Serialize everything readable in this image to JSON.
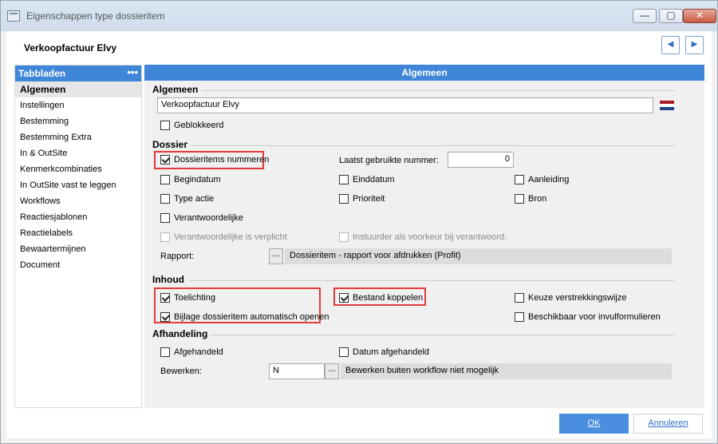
{
  "window": {
    "title": "Eigenschappen type dossieritem",
    "minimize_glyph": "—",
    "maximize_glyph": "▢",
    "close_glyph": "✕"
  },
  "header": {
    "title": "Verkoopfactuur Elvy",
    "prev_glyph": "◀",
    "next_glyph": "▶"
  },
  "sidebar": {
    "title": "Tabbladen",
    "more_glyph": "•••",
    "items": [
      {
        "label": "Algemeen",
        "active": true
      },
      {
        "label": "Instellingen"
      },
      {
        "label": "Bestemming"
      },
      {
        "label": "Bestemming Extra"
      },
      {
        "label": "In & OutSite"
      },
      {
        "label": "Kenmerkcombinaties"
      },
      {
        "label": "In OutSite vast te leggen"
      },
      {
        "label": "Workflows"
      },
      {
        "label": "Reactiesjablonen"
      },
      {
        "label": "Reactielabels"
      },
      {
        "label": "Bewaartermijnen"
      },
      {
        "label": "Document"
      }
    ]
  },
  "main": {
    "title": "Algemeen",
    "algemeen": {
      "section": "Algemeen",
      "name_value": "Verkoopfactuur Elvy",
      "geblokkeerd": {
        "label": "Geblokkeerd",
        "checked": false
      }
    },
    "dossier": {
      "section": "Dossier",
      "nummeren": {
        "label": "Dossieritems nummeren",
        "checked": true
      },
      "laatst_label": "Laatst gebruikte nummer:",
      "laatst_value": "0",
      "begindatum": {
        "label": "Begindatum",
        "checked": false
      },
      "einddatum": {
        "label": "Einddatum",
        "checked": false
      },
      "aanleiding": {
        "label": "Aanleiding",
        "checked": false
      },
      "type_actie": {
        "label": "Type actie",
        "checked": false
      },
      "prioriteit": {
        "label": "Prioriteit",
        "checked": false
      },
      "bron": {
        "label": "Bron",
        "checked": false
      },
      "verantwoordelijke": {
        "label": "Verantwoordelijke",
        "checked": false
      },
      "verplicht": {
        "label": "Verantwoordelijke is verplicht",
        "checked": false
      },
      "instuurder": {
        "label": "Instuurder als voorkeur bij verantwoord.",
        "checked": false
      },
      "rapport_label": "Rapport:",
      "rapport_button": "...",
      "rapport_value": "Dossieritem - rapport voor afdrukken (Profit)"
    },
    "inhoud": {
      "section": "Inhoud",
      "toelichting": {
        "label": "Toelichting",
        "checked": true
      },
      "bijlage": {
        "label": "Bijlage dossieritem automatisch openen",
        "checked": true
      },
      "bestand": {
        "label": "Bestand koppelen",
        "checked": true
      },
      "keuze": {
        "label": "Keuze verstrekkingswijze",
        "checked": false
      },
      "beschikbaar": {
        "label": "Beschikbaar voor invulformulieren",
        "checked": false
      }
    },
    "afhandeling": {
      "section": "Afhandeling",
      "afgehandeld": {
        "label": "Afgehandeld",
        "checked": false
      },
      "datum": {
        "label": "Datum afgehandeld",
        "checked": false
      },
      "bewerken_label": "Bewerken:",
      "bewerken_value": "N",
      "bewerken_button": "...",
      "bewerken_desc": "Bewerken buiten workflow niet mogelijk"
    }
  },
  "footer": {
    "ok_label": "OK",
    "cancel_label": "Annuleren"
  },
  "colors": {
    "accent": "#3f86d8",
    "highlight": "#e23b3b"
  }
}
